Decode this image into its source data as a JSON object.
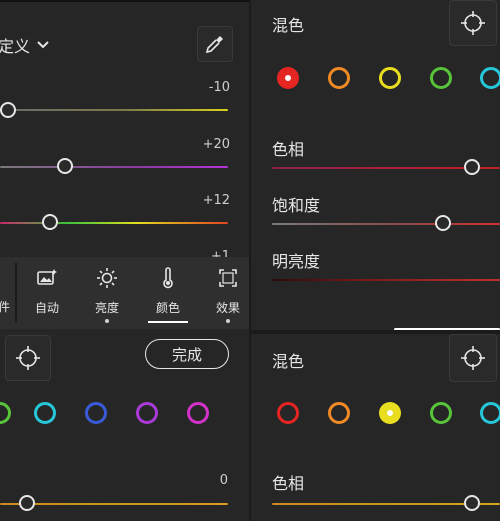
{
  "top_left": {
    "dropdown_label": "定义",
    "sliders": [
      {
        "value": "-10"
      },
      {
        "value": "+20"
      },
      {
        "value": "+12"
      },
      {
        "value": "+1"
      }
    ]
  },
  "toolbar": {
    "partial_left_label": "件",
    "tabs": [
      {
        "label": "自动",
        "icon": "auto-image-icon"
      },
      {
        "label": "亮度",
        "icon": "sun-icon"
      },
      {
        "label": "颜色",
        "icon": "thermometer-icon",
        "active": true
      },
      {
        "label": "效果",
        "icon": "effects-icon"
      }
    ]
  },
  "bottom_left": {
    "done_label": "完成",
    "slider_value": "0",
    "swatches": [
      "green",
      "aqua",
      "blue",
      "purple",
      "magenta"
    ]
  },
  "right_top": {
    "mix_label": "混色",
    "hue_label": "色相",
    "saturation_label": "饱和度",
    "luminance_label": "明亮度",
    "swatches": [
      "red",
      "orange",
      "yellow",
      "green",
      "aqua"
    ],
    "selected": "red"
  },
  "right_bottom": {
    "mix_label": "混色",
    "hue_label": "色相",
    "swatches": [
      "red",
      "orange",
      "yellow",
      "green",
      "aqua"
    ],
    "selected": "yellow"
  },
  "colors": {
    "red": "#e52521",
    "orange": "#f08a24",
    "yellow": "#e8dd1e",
    "green": "#58c43a",
    "aqua": "#25c7d9",
    "blue": "#3a5bd8",
    "purple": "#a93ad6",
    "magenta": "#d232c8",
    "accent_white": "#ffffff"
  }
}
